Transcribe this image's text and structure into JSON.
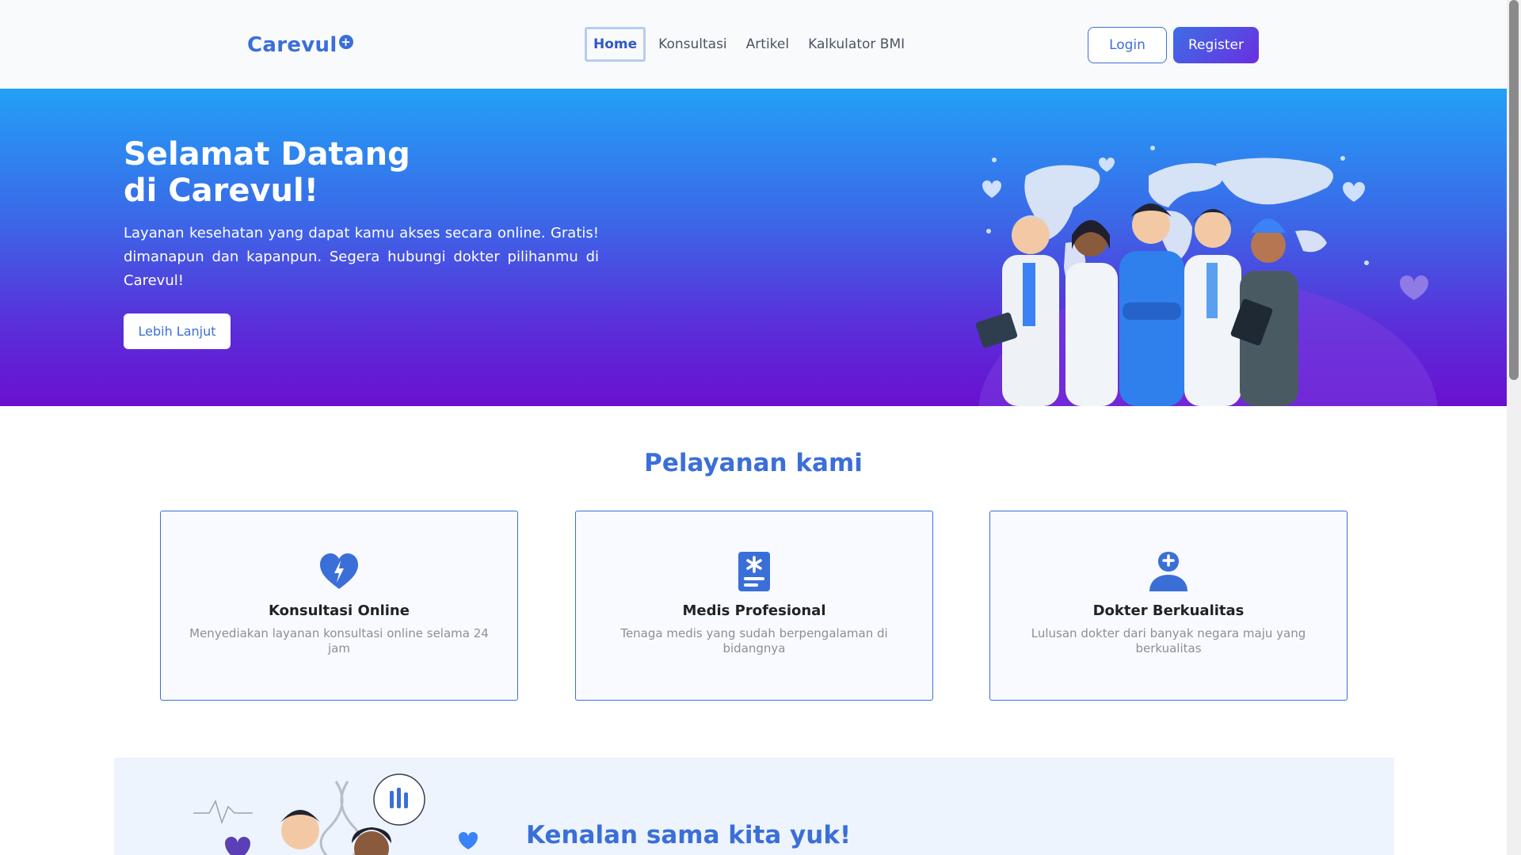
{
  "navbar": {
    "brand": "Carevul",
    "links": [
      {
        "label": "Home",
        "active": true
      },
      {
        "label": "Konsultasi",
        "active": false
      },
      {
        "label": "Artikel",
        "active": false
      },
      {
        "label": "Kalkulator BMI",
        "active": false
      }
    ],
    "login_label": "Login",
    "register_label": "Register"
  },
  "hero": {
    "title": "Selamat Datang\ndi Carevul!",
    "description": "Layanan kesehatan yang dapat kamu akses secara online. Gratis! dimanapun dan kapanpun. Segera hubungi dokter pilihanmu di Carevul!",
    "button_label": "Lebih Lanjut"
  },
  "services": {
    "title": "Pelayanan kami",
    "items": [
      {
        "icon": "heart-bolt-icon",
        "name": "Konsultasi Online",
        "description": "Menyediakan layanan konsultasi online selama 24 jam"
      },
      {
        "icon": "medical-file-icon",
        "name": "Medis Profesional",
        "description": "Tenaga medis yang sudah berpengalaman di bidangnya"
      },
      {
        "icon": "doctor-icon",
        "name": "Dokter Berkualitas",
        "description": "Lulusan dokter dari banyak negara maju yang berkualitas"
      }
    ]
  },
  "about": {
    "title": "Kenalan sama kita yuk!"
  },
  "colors": {
    "primary": "#3b6fd8",
    "hero_top": "#22a0f7",
    "hero_bottom": "#6a10d0",
    "card_border": "#3b6fd8"
  }
}
